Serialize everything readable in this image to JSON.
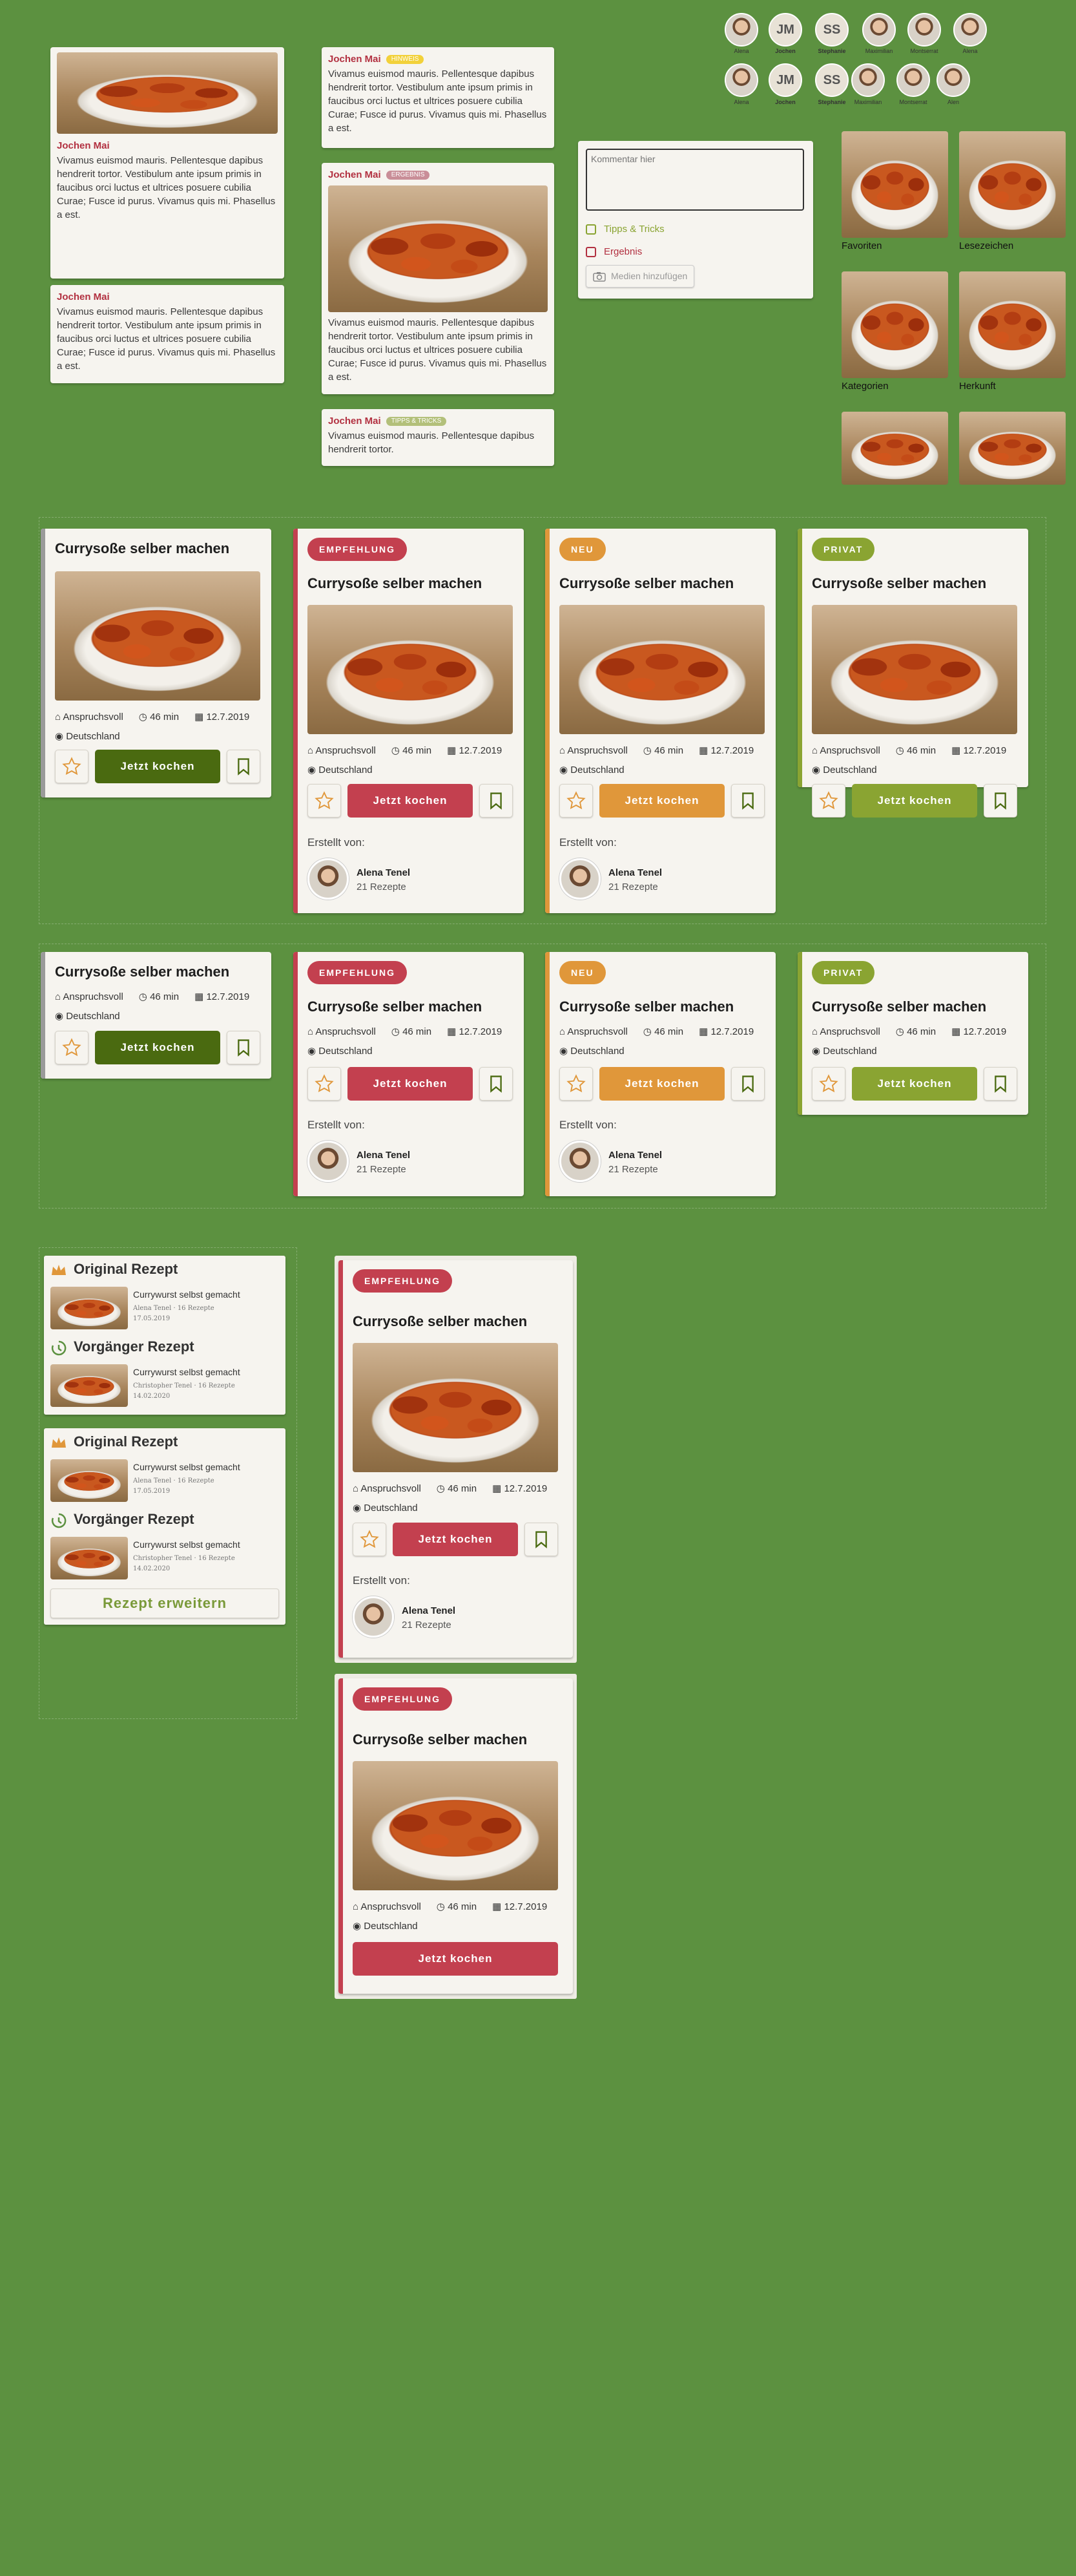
{
  "comments": {
    "author": "Jochen Mai",
    "long_text": "Vivamus euismod mauris. Pellentesque dapibus hendrerit tortor. Vestibulum ante ipsum primis in faucibus orci luctus et ultrices posuere cubilia Curae; Fusce id purus. Vivamus quis mi. Phasellus a est.",
    "short_text": "Vivamus euismod mauris. Pellentesque dapibus hendrerit tortor.",
    "tag_hint": "HINWEIS",
    "tag_result": "ERGEBNIS",
    "tag_tips": "TIPPS & TRICKS"
  },
  "avatars": {
    "row1": [
      "Alena",
      "Jochen",
      "Stephanie",
      "Maximilian",
      "Montserrat",
      "Alena"
    ],
    "row2": [
      "Alena",
      "Jochen",
      "Stephanie",
      "Maximilian",
      "Montserrat",
      "Alen"
    ],
    "initials_jm": "JM",
    "initials_ss": "SS"
  },
  "comment_form": {
    "placeholder": "Kommentar hier",
    "option_tips": "Tipps & Tricks",
    "option_result": "Ergebnis",
    "media_button": "Medien hinzufügen"
  },
  "gallery": {
    "labels": [
      "Favoriten",
      "Lesezeichen",
      "Kategorien",
      "Herkunft"
    ]
  },
  "recipe": {
    "title": "Currysoße selber machen",
    "difficulty": "Anspruchsvoll",
    "duration": "46 min",
    "date": "12.7.2019",
    "origin": "Deutschland",
    "cook_button": "Jetzt kochen",
    "created_by": "Erstellt von:",
    "creator_name": "Alena Tenel",
    "creator_count": "21 Rezepte",
    "badge_recommend": "EMPFEHLUNG",
    "badge_new": "NEU",
    "badge_private": "PRIVAT"
  },
  "history": {
    "original": "Original Rezept",
    "predecessor": "Vorgänger Rezept",
    "recipe_title": "Currywurst selbst gemacht",
    "original_author": "Alena Tenel · 16 Rezepte",
    "original_date": "17.05.2019",
    "pred_author": "Christopher Tenel · 16 Rezepte",
    "pred_date": "14.02.2020",
    "extend_button": "Rezept erweitern"
  },
  "colors": {
    "background": "#5c9140",
    "recommend": "#c3404f",
    "new": "#e0973a",
    "private": "#8aa432",
    "default_button": "#4a6a10"
  }
}
